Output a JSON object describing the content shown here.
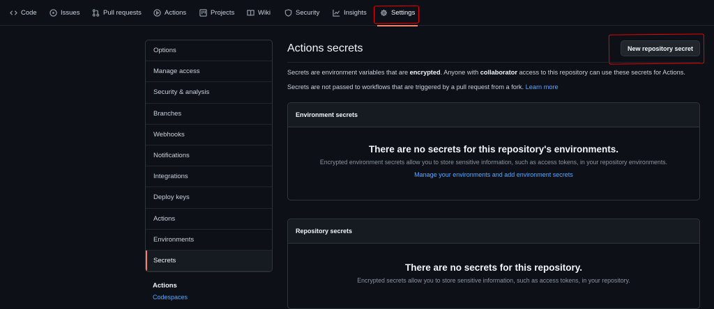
{
  "nav": {
    "tabs": [
      {
        "label": "Code",
        "icon": "code-icon"
      },
      {
        "label": "Issues",
        "icon": "issue-icon"
      },
      {
        "label": "Pull requests",
        "icon": "pull-request-icon"
      },
      {
        "label": "Actions",
        "icon": "play-icon"
      },
      {
        "label": "Projects",
        "icon": "project-icon"
      },
      {
        "label": "Wiki",
        "icon": "book-icon"
      },
      {
        "label": "Security",
        "icon": "shield-icon"
      },
      {
        "label": "Insights",
        "icon": "graph-icon"
      },
      {
        "label": "Settings",
        "icon": "gear-icon"
      }
    ],
    "selected": "Settings"
  },
  "sidebar": {
    "items": [
      {
        "label": "Options"
      },
      {
        "label": "Manage access"
      },
      {
        "label": "Security & analysis"
      },
      {
        "label": "Branches"
      },
      {
        "label": "Webhooks"
      },
      {
        "label": "Notifications"
      },
      {
        "label": "Integrations"
      },
      {
        "label": "Deploy keys"
      },
      {
        "label": "Actions"
      },
      {
        "label": "Environments"
      },
      {
        "label": "Secrets"
      }
    ],
    "selected": "Secrets",
    "section_heading": "Actions",
    "section_link": "Codespaces"
  },
  "main": {
    "title": "Actions secrets",
    "new_button": "New repository secret",
    "desc1": {
      "a": "Secrets are environment variables that are ",
      "b": "encrypted",
      "c": ". Anyone with ",
      "d": "collaborator",
      "e": " access to this repository can use these secrets for Actions."
    },
    "desc2": {
      "text": "Secrets are not passed to workflows that are triggered by a pull request from a fork. ",
      "link": "Learn more"
    },
    "env_box": {
      "header": "Environment secrets",
      "empty_title": "There are no secrets for this repository's environments.",
      "empty_text": "Encrypted environment secrets allow you to store sensitive information, such as access tokens, in your repository environments.",
      "link": "Manage your environments and add environment secrets"
    },
    "repo_box": {
      "header": "Repository secrets",
      "empty_title": "There are no secrets for this repository.",
      "empty_text": "Encrypted secrets allow you to store sensitive information, such as access tokens, in your repository."
    }
  },
  "colors": {
    "background": "#0d1117",
    "accent": "#f78166",
    "link": "#58a6ff",
    "annotation": "#ee0000"
  }
}
